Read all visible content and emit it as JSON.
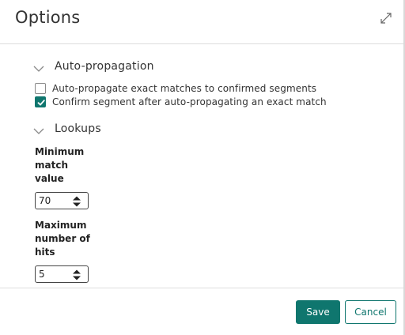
{
  "dialog": {
    "title": "Options",
    "expand_icon": "expand-arrows-icon"
  },
  "sections": {
    "auto_propagation": {
      "title": "Auto-propagation",
      "options": [
        {
          "label": "Auto-propagate exact matches to confirmed segments",
          "checked": false
        },
        {
          "label": "Confirm segment after auto-propagating an exact match",
          "checked": true
        }
      ]
    },
    "lookups": {
      "title": "Lookups",
      "min_match": {
        "label_lines": [
          "Minimum",
          "match",
          "value"
        ],
        "value": "70"
      },
      "max_hits": {
        "label_lines": [
          "Maximum",
          "number of",
          "hits"
        ],
        "value": "5"
      }
    }
  },
  "footer": {
    "save_label": "Save",
    "cancel_label": "Cancel"
  },
  "colors": {
    "accent": "#0f766e"
  }
}
